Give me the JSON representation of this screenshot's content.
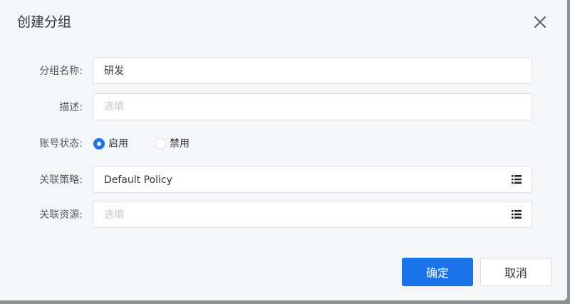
{
  "dialog": {
    "title": "创建分组",
    "close_icon": "close-icon"
  },
  "form": {
    "group_name": {
      "label": "分组名称:",
      "value": "研发"
    },
    "description": {
      "label": "描述:",
      "value": "",
      "placeholder": "选填"
    },
    "account_status": {
      "label": "账号状态:",
      "options": [
        {
          "label": "启用",
          "selected": true
        },
        {
          "label": "禁用",
          "selected": false
        }
      ]
    },
    "policy": {
      "label": "关联策略:",
      "value": "Default Policy",
      "icon": "list-icon"
    },
    "resources": {
      "label": "关联资源:",
      "placeholder": "选填",
      "icon": "list-icon"
    }
  },
  "footer": {
    "confirm_label": "确定",
    "cancel_label": "取消"
  },
  "colors": {
    "accent": "#1a73e8",
    "dialog_bg": "#f5f6f8",
    "border": "#dcdfe6",
    "placeholder": "#c0c4cc"
  }
}
